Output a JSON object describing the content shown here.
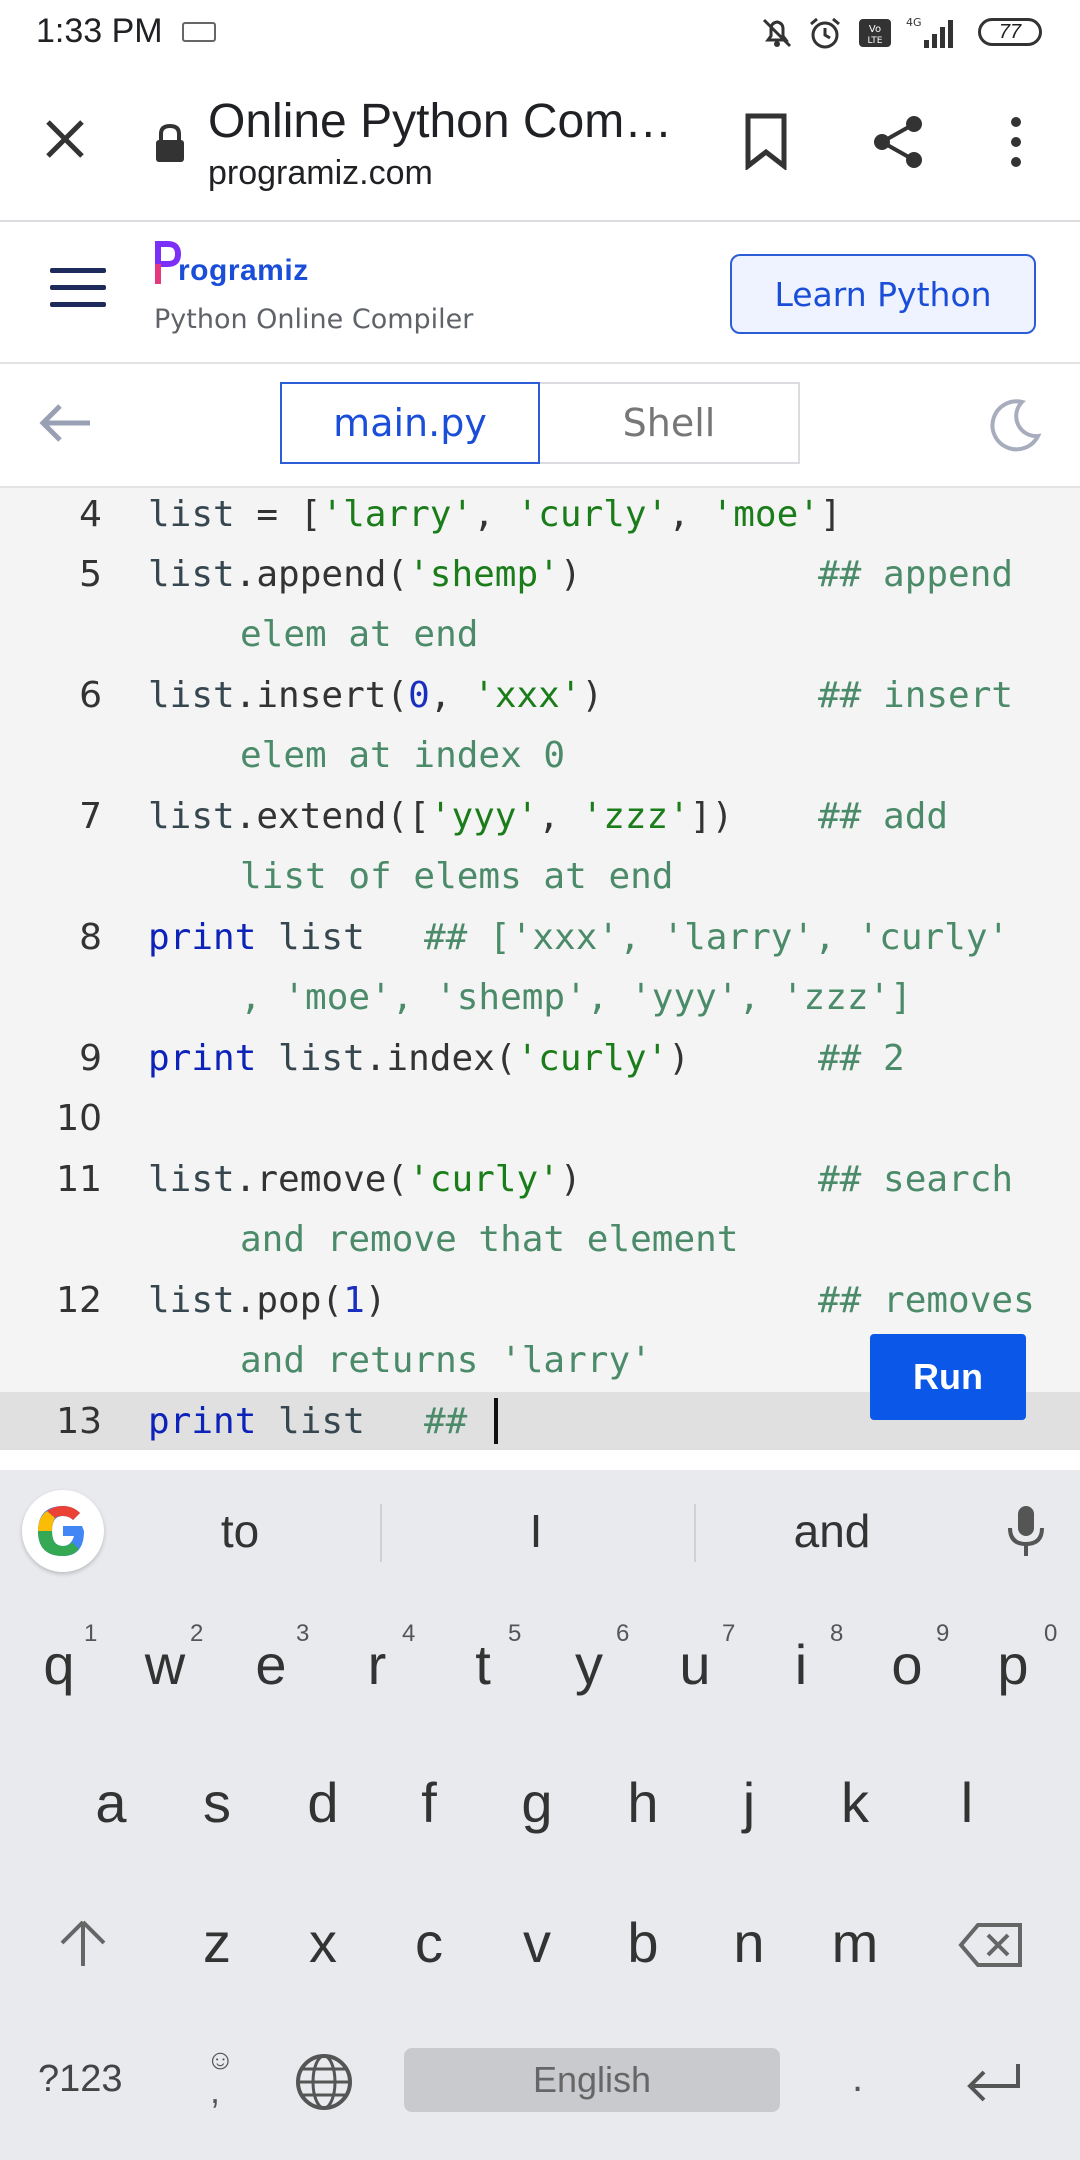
{
  "status_bar": {
    "time": "1:33 PM",
    "battery": "77",
    "network": "4G"
  },
  "browser": {
    "title": "Online Python Com…",
    "url": "programiz.com"
  },
  "site": {
    "logo": "rogramiz",
    "subtitle": "Python Online Compiler",
    "learn_button": "Learn Python"
  },
  "tabs": {
    "main": "main.py",
    "shell": "Shell"
  },
  "editor": {
    "line_numbers": [
      "4",
      "5",
      "6",
      "7",
      "8",
      "9",
      "10",
      "11",
      "12",
      "13"
    ],
    "run_label": "Run",
    "code": {
      "l4": {
        "a": "list",
        "b": " = [",
        "c": "'larry'",
        "d": ", ",
        "e": "'curly'",
        "f": ", ",
        "g": "'moe'",
        "h": "]"
      },
      "l5": {
        "a": "list",
        "b": ".append(",
        "c": "'shemp'",
        "d": ")",
        "comment1": "## append",
        "comment2": "elem at end"
      },
      "l6": {
        "a": "list",
        "b": ".insert(",
        "n": "0",
        "c": ", ",
        "s": "'xxx'",
        "d": ")",
        "comment1": "## insert",
        "comment2": "elem at index 0"
      },
      "l7": {
        "a": "list",
        "b": ".extend([",
        "s1": "'yyy'",
        "c": ", ",
        "s2": "'zzz'",
        "d": "])",
        "comment1": "## add",
        "comment2": "list of elems at end"
      },
      "l8": {
        "kw": "print",
        "a": " list",
        "comment1": "## ['xxx', 'larry', 'curly'",
        "comment2": ", 'moe', 'shemp', 'yyy', 'zzz']"
      },
      "l9": {
        "kw": "print",
        "a": " list",
        "b": ".index(",
        "s": "'curly'",
        "d": ")",
        "comment1": "## 2"
      },
      "l11": {
        "a": "list",
        "b": ".remove(",
        "s": "'curly'",
        "d": ")",
        "comment1": "## search",
        "comment2": "and remove that element"
      },
      "l12": {
        "a": "list",
        "b": ".pop(",
        "n": "1",
        "d": ")",
        "comment1": "## removes",
        "comment2": "and returns 'larry'"
      },
      "l13": {
        "kw": "print",
        "a": " list",
        "comment1": "##"
      }
    }
  },
  "keyboard": {
    "suggestions": [
      "to",
      "I",
      "and"
    ],
    "row1": [
      "q",
      "w",
      "e",
      "r",
      "t",
      "y",
      "u",
      "i",
      "o",
      "p"
    ],
    "row1_hints": [
      "1",
      "2",
      "3",
      "4",
      "5",
      "6",
      "7",
      "8",
      "9",
      "0"
    ],
    "row2": [
      "a",
      "s",
      "d",
      "f",
      "g",
      "h",
      "j",
      "k",
      "l"
    ],
    "row3": [
      "z",
      "x",
      "c",
      "v",
      "b",
      "n",
      "m"
    ],
    "symbols_key": "?123",
    "comma": ",",
    "space_label": "English",
    "period": "."
  },
  "colors": {
    "accent": "#1a4ed8",
    "run_button": "#0b57e8",
    "keyword": "#0d22b8",
    "string": "#1a7d1a",
    "comment": "#4b8b6a"
  }
}
